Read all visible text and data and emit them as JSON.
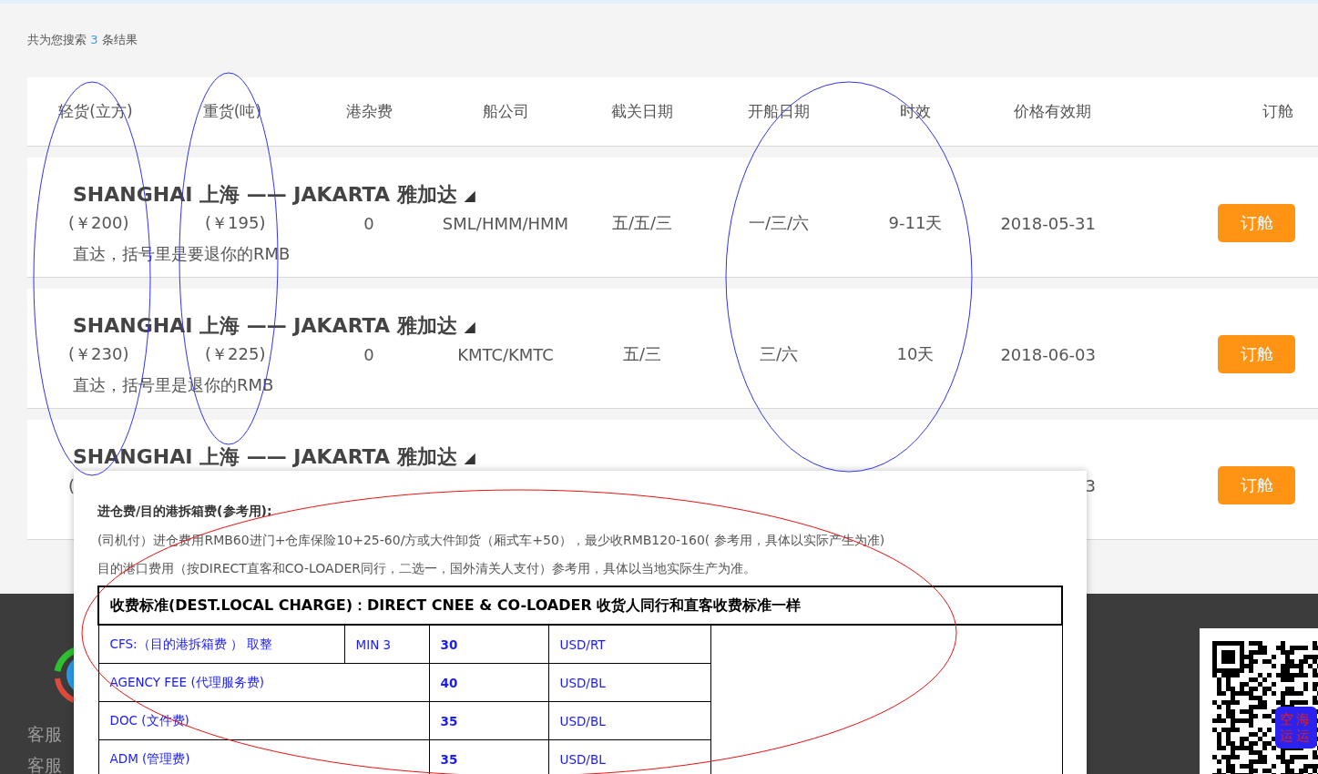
{
  "result": {
    "prefix": "共为您搜索",
    "count": "3",
    "suffix": "条结果"
  },
  "columns": [
    "轻货(立方)",
    "重货(吨)",
    "港杂费",
    "船公司",
    "截关日期",
    "开船日期",
    "时效",
    "价格有效期",
    "订舱"
  ],
  "rows": [
    {
      "route": "SHANGHAI 上海 —— JAKARTA 雅加达",
      "toggle": "◢",
      "cells": {
        "light": "(￥200)",
        "heavy": "(￥195)",
        "port_fee": "0",
        "carrier": "SML/HMM/HMM",
        "cutoff": "五/五/三",
        "sailing": "一/三/六",
        "transit": "9-11天",
        "validity": "2018-05-31"
      },
      "note": "直达，括号里是要退你的RMB",
      "button": "订舱"
    },
    {
      "route": "SHANGHAI 上海 —— JAKARTA 雅加达",
      "toggle": "◢",
      "cells": {
        "light": "(￥230)",
        "heavy": "(￥225)",
        "port_fee": "0",
        "carrier": "KMTC/KMTC",
        "cutoff": "五/三",
        "sailing": "三/六",
        "transit": "10天",
        "validity": "2018-06-03"
      },
      "note": "直达，括号里是退你的RMB",
      "button": "订舱"
    },
    {
      "route": "SHANGHAI 上海 —— JAKARTA 雅加达",
      "toggle": "◢",
      "cells": {
        "light": "(",
        "validity": "3"
      },
      "button": "订舱"
    }
  ],
  "popup": {
    "title": "进仓费/目的港拆箱费(参考用):",
    "lines": [
      "(司机付）进仓费用RMB60进门+仓库保险10+25-60/方或大件卸货（厢式车+50），最少收RMB120-160( 参考用，具体以实际产生为准)",
      "目的港口费用（按DIRECT直客和CO-LOADER同行，二选一，国外清关人支付）参考用，具体以当地实际生产为准。"
    ],
    "table": {
      "header": "收费标准(DEST.LOCAL CHARGE)：DIRECT CNEE & CO-LOADER 收货人同行和直客收费标准一样",
      "rows": [
        {
          "item": "CFS:（目的港拆箱费 ） 取整",
          "min": "MIN 3",
          "amount": "30",
          "unit": "USD/RT"
        },
        {
          "item": "AGENCY FEE (代理服务费)",
          "amount": "40",
          "unit": "USD/BL"
        },
        {
          "item": "DOC (文件费)",
          "amount": "35",
          "unit": "USD/BL"
        },
        {
          "item": "ADM (管理费)",
          "amount": "35",
          "unit": "USD/BL"
        }
      ]
    }
  },
  "footer": {
    "labels": [
      "客服",
      "客服"
    ],
    "qr_badge": [
      "空海",
      "运运"
    ]
  },
  "annotations": [
    {
      "color": "#3333ee"
    },
    {
      "color": "#3333ee"
    },
    {
      "color": "#3333ee"
    },
    {
      "color": "#ee1111"
    }
  ]
}
